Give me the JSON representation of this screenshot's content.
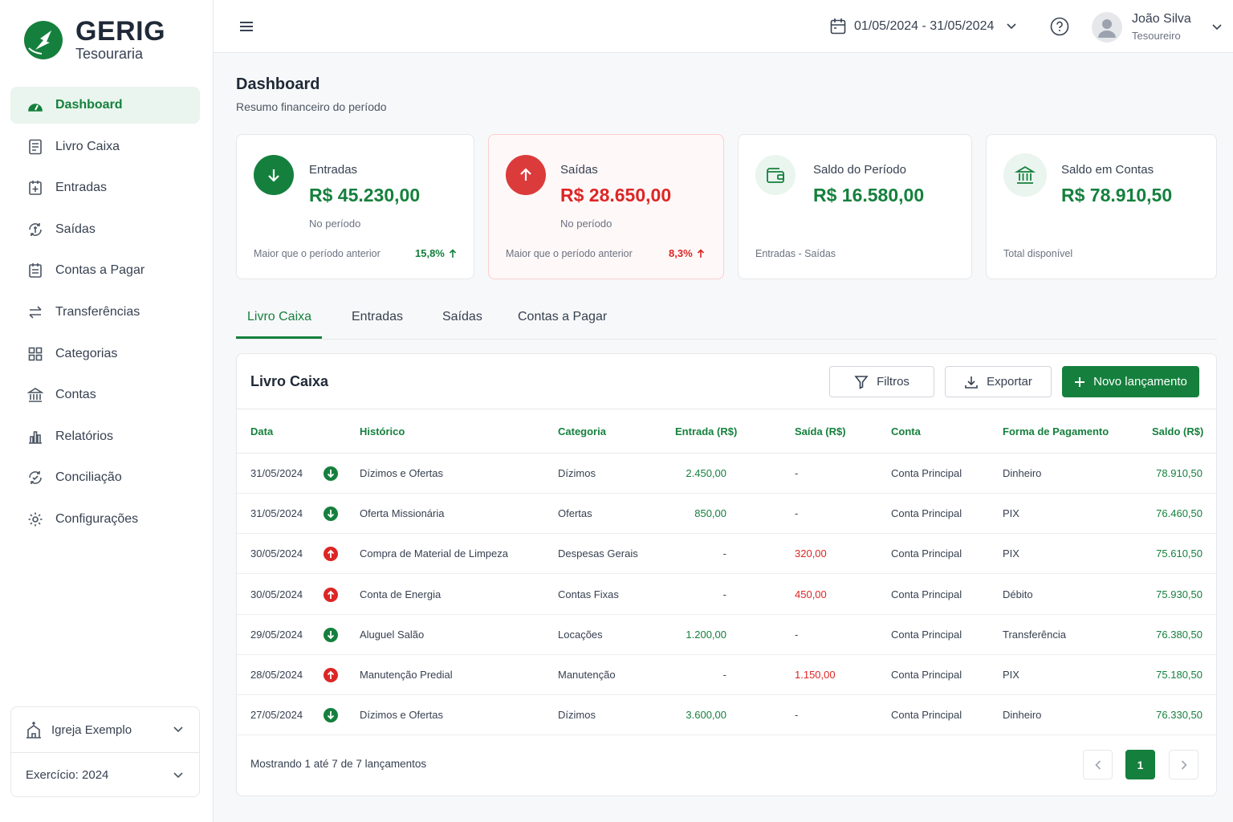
{
  "brand": {
    "name": "GERIG",
    "subtitle": "Tesouraria"
  },
  "sidebar": {
    "items": [
      {
        "label": "Dashboard",
        "icon": "dashboard-icon",
        "active": true
      },
      {
        "label": "Livro Caixa",
        "icon": "book-icon"
      },
      {
        "label": "Entradas",
        "icon": "calendar-plus-icon"
      },
      {
        "label": "Saídas",
        "icon": "exchange-icon"
      },
      {
        "label": "Contas a Pagar",
        "icon": "calendar-list-icon"
      },
      {
        "label": "Transferências",
        "icon": "transfer-icon"
      },
      {
        "label": "Categorias",
        "icon": "grid-icon"
      },
      {
        "label": "Contas",
        "icon": "bank-icon"
      },
      {
        "label": "Relatórios",
        "icon": "bar-chart-icon"
      },
      {
        "label": "Conciliação",
        "icon": "reconcile-icon"
      },
      {
        "label": "Configurações",
        "icon": "gear-icon"
      }
    ],
    "church": "Igreja Exemplo",
    "exercise": "Exercício: 2024"
  },
  "topbar": {
    "date_range": "01/05/2024 - 31/05/2024",
    "user_name": "João Silva",
    "user_role": "Tesoureiro"
  },
  "page": {
    "title": "Dashboard",
    "subtitle": "Resumo financeiro do período"
  },
  "cards": [
    {
      "label": "Entradas",
      "value": "R$ 45.230,00",
      "note": "No período",
      "footer": "Maior que o período anterior",
      "pct": "15,8%",
      "color": "#15803d"
    },
    {
      "label": "Saídas",
      "value": "R$ 28.650,00",
      "note": "No período",
      "footer": "Maior que o período anterior",
      "pct": "8,3%",
      "color": "#dc2626"
    },
    {
      "label": "Saldo do Período",
      "value": "R$ 16.580,00",
      "footer": "Entradas - Saídas",
      "color": "#15803d"
    },
    {
      "label": "Saldo em Contas",
      "value": "R$ 78.910,50",
      "footer": "Total disponível",
      "color": "#15803d"
    }
  ],
  "tabs": [
    "Livro Caixa",
    "Entradas",
    "Saídas",
    "Contas a Pagar"
  ],
  "panel": {
    "title": "Livro Caixa",
    "filters_label": "Filtros",
    "export_label": "Exportar",
    "new_label": "Novo lançamento"
  },
  "table": {
    "headers": [
      "Data",
      "Histórico",
      "Categoria",
      "Entrada (R$)",
      "Saída (R$)",
      "Conta",
      "Forma de Pagamento",
      "Saldo (R$)"
    ],
    "rows": [
      {
        "date": "31/05/2024",
        "type": "in",
        "history": "Dízimos e Ofertas",
        "category": "Dízimos",
        "in": "2.450,00",
        "out": "-",
        "account": "Conta Principal",
        "payment": "Dinheiro",
        "balance": "78.910,50"
      },
      {
        "date": "31/05/2024",
        "type": "in",
        "history": "Oferta Missionária",
        "category": "Ofertas",
        "in": "850,00",
        "out": "-",
        "account": "Conta Principal",
        "payment": "PIX",
        "balance": "76.460,50"
      },
      {
        "date": "30/05/2024",
        "type": "out",
        "history": "Compra de Material de Limpeza",
        "category": "Despesas Gerais",
        "in": "-",
        "out": "320,00",
        "account": "Conta Principal",
        "payment": "PIX",
        "balance": "75.610,50"
      },
      {
        "date": "30/05/2024",
        "type": "out",
        "history": "Conta de Energia",
        "category": "Contas Fixas",
        "in": "-",
        "out": "450,00",
        "account": "Conta Principal",
        "payment": "Débito",
        "balance": "75.930,50"
      },
      {
        "date": "29/05/2024",
        "type": "in",
        "history": "Aluguel Salão",
        "category": "Locações",
        "in": "1.200,00",
        "out": "-",
        "account": "Conta Principal",
        "payment": "Transferência",
        "balance": "76.380,50"
      },
      {
        "date": "28/05/2024",
        "type": "out",
        "history": "Manutenção Predial",
        "category": "Manutenção",
        "in": "-",
        "out": "1.150,00",
        "account": "Conta Principal",
        "payment": "PIX",
        "balance": "75.180,50"
      },
      {
        "date": "27/05/2024",
        "type": "in",
        "history": "Dízimos e Ofertas",
        "category": "Dízimos",
        "in": "3.600,00",
        "out": "-",
        "account": "Conta Principal",
        "payment": "Dinheiro",
        "balance": "76.330,50"
      }
    ]
  },
  "pagination": {
    "showing": "Mostrando 1 até 7 de 7 lançamentos",
    "current_page": "1"
  },
  "colors": {
    "primary": "#15803d",
    "danger": "#dc2626"
  }
}
